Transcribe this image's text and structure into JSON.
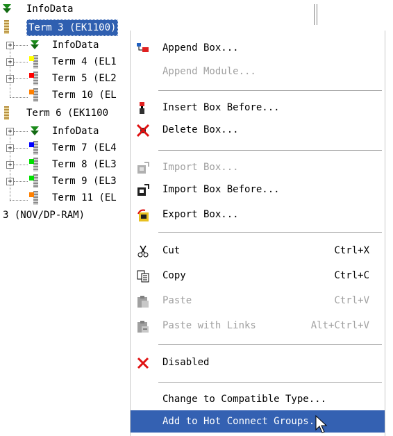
{
  "tree": {
    "items": [
      {
        "label": "InfoData",
        "type": "info"
      },
      {
        "label": "Term 3 (EK1100)",
        "type": "coupler",
        "selected": true
      },
      {
        "label": "InfoData",
        "type": "info"
      },
      {
        "label": "Term 4 (EL1",
        "type": "terminal",
        "led": "#ffff00"
      },
      {
        "label": "Term 5 (EL2",
        "type": "terminal",
        "led": "#ff0000"
      },
      {
        "label": "Term 10 (EL",
        "type": "terminal",
        "led": "#ff8000"
      },
      {
        "label": "Term 6 (EK1100",
        "type": "coupler"
      },
      {
        "label": "InfoData",
        "type": "info"
      },
      {
        "label": "Term 7 (EL4",
        "type": "terminal",
        "led": "#0000ff"
      },
      {
        "label": "Term 8 (EL3",
        "type": "terminal",
        "led": "#00e000"
      },
      {
        "label": "Term 9 (EL3",
        "type": "terminal",
        "led": "#00e000"
      },
      {
        "label": "Term 11 (EL",
        "type": "terminal",
        "led": "#ff8000"
      },
      {
        "label": "3 (NOV/DP-RAM)",
        "type": "plain"
      }
    ]
  },
  "context_menu": {
    "items": [
      {
        "label": "Append Box...",
        "icon": "append-box-icon"
      },
      {
        "label": "Append Module...",
        "disabled": true
      },
      {
        "label": "Insert Box Before...",
        "icon": "insert-box-icon"
      },
      {
        "label": "Delete Box...",
        "icon": "delete-box-icon"
      },
      {
        "label": "Import Box...",
        "icon": "import-box-icon",
        "disabled": true
      },
      {
        "label": "Import Box Before...",
        "icon": "import-box-before-icon"
      },
      {
        "label": "Export Box...",
        "icon": "export-box-icon"
      },
      {
        "label": "Cut",
        "shortcut": "Ctrl+X",
        "icon": "scissors-icon"
      },
      {
        "label": "Copy",
        "shortcut": "Ctrl+C",
        "icon": "copy-icon"
      },
      {
        "label": "Paste",
        "shortcut": "Ctrl+V",
        "icon": "paste-icon",
        "disabled": true
      },
      {
        "label": "Paste with Links",
        "shortcut": "Alt+Ctrl+V",
        "icon": "paste-links-icon",
        "disabled": true
      },
      {
        "label": "Disabled",
        "icon": "red-x-icon"
      },
      {
        "label": "Change to Compatible Type..."
      },
      {
        "label": "Add to Hot Connect Groups...",
        "highlighted": true
      }
    ]
  },
  "colors": {
    "selection": "#2f5fb0",
    "menu_highlight": "#3461b2",
    "disabled_text": "#a0a0a0"
  }
}
